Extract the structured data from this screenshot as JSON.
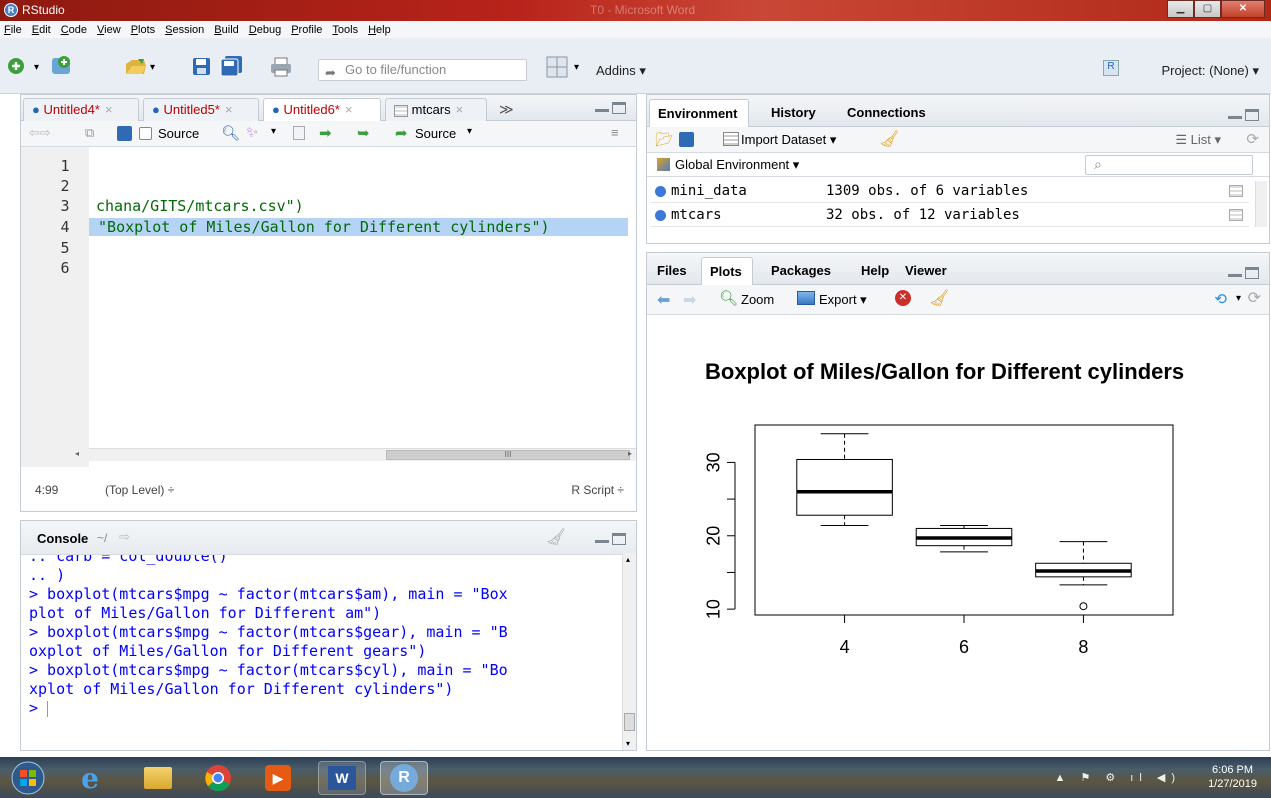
{
  "window": {
    "title": "RStudio",
    "center_title": "T0 - Microsoft Word"
  },
  "menu": [
    "File",
    "Edit",
    "Code",
    "View",
    "Plots",
    "Session",
    "Build",
    "Debug",
    "Profile",
    "Tools",
    "Help"
  ],
  "toolbar": {
    "goto_placeholder": "Go to file/function",
    "addins_label": "Addins ▾",
    "project_label": "Project: (None) ▾"
  },
  "editor": {
    "tabs": [
      {
        "label": "Untitled4*",
        "active": false
      },
      {
        "label": "Untitled5*",
        "active": false
      },
      {
        "label": "Untitled6*",
        "active": true
      },
      {
        "label": "mtcars",
        "active": false
      }
    ],
    "source_checkbox_label": "Source",
    "source_button_label": "Source",
    "lines": [
      {
        "num": "1",
        "text": ""
      },
      {
        "num": "2",
        "text": ""
      },
      {
        "num": "3",
        "text": "chana/GITS/mtcars.csv\")"
      },
      {
        "num": "4",
        "text": " \"Boxplot of Miles/Gallon for Different cylinders\")"
      },
      {
        "num": "5",
        "text": ""
      },
      {
        "num": "6",
        "text": ""
      }
    ],
    "status_position": "4:99",
    "status_scope": "(Top Level) ÷",
    "status_type": "R Script ÷"
  },
  "console": {
    "title": "Console",
    "path": "~/",
    "lines": [
      "  ..   carb = col_double()",
      "  .. )",
      "> boxplot(mtcars$mpg ~ factor(mtcars$am), main = \"Box",
      "plot of Miles/Gallon for Different am\")",
      "> boxplot(mtcars$mpg ~ factor(mtcars$gear), main = \"B",
      "oxplot of Miles/Gallon for Different gears\")",
      "> boxplot(mtcars$mpg ~ factor(mtcars$cyl), main = \"Bo",
      "xplot of Miles/Gallon for Different cylinders\")",
      "> "
    ]
  },
  "environment": {
    "tabs": [
      "Environment",
      "History",
      "Connections"
    ],
    "import_label": "Import Dataset ▾",
    "list_label": "List ▾",
    "scope_label": "Global Environment ▾",
    "rows": [
      {
        "name": "mini_data",
        "value": "1309 obs. of 6 variables"
      },
      {
        "name": "mtcars",
        "value": "32 obs. of 12 variables"
      }
    ]
  },
  "plots": {
    "tabs": [
      "Files",
      "Plots",
      "Packages",
      "Help",
      "Viewer"
    ],
    "zoom_label": "Zoom",
    "export_label": "Export ▾"
  },
  "chart_data": {
    "type": "boxplot",
    "title": "Boxplot of Miles/Gallon for Different cylinders",
    "categories": [
      "4",
      "6",
      "8"
    ],
    "boxes": [
      {
        "category": "4",
        "min": 21.4,
        "q1": 22.8,
        "median": 26.0,
        "q3": 30.4,
        "max": 33.9,
        "outliers": []
      },
      {
        "category": "6",
        "min": 17.8,
        "q1": 18.65,
        "median": 19.7,
        "q3": 21.0,
        "max": 21.4,
        "outliers": []
      },
      {
        "category": "8",
        "min": 13.3,
        "q1": 14.4,
        "median": 15.2,
        "q3": 16.25,
        "max": 19.2,
        "outliers": [
          10.4
        ]
      }
    ],
    "yticks": [
      10,
      20,
      30
    ],
    "ylim": [
      9.2,
      35.1
    ],
    "xlabel": "",
    "ylabel": ""
  },
  "taskbar": {
    "time": "6:06 PM",
    "date": "1/27/2019"
  },
  "colors": {
    "r_blue": "#2165b6",
    "code_green": "#036a07",
    "console_blue": "#0000ff",
    "selection": "#b5d4f5"
  }
}
